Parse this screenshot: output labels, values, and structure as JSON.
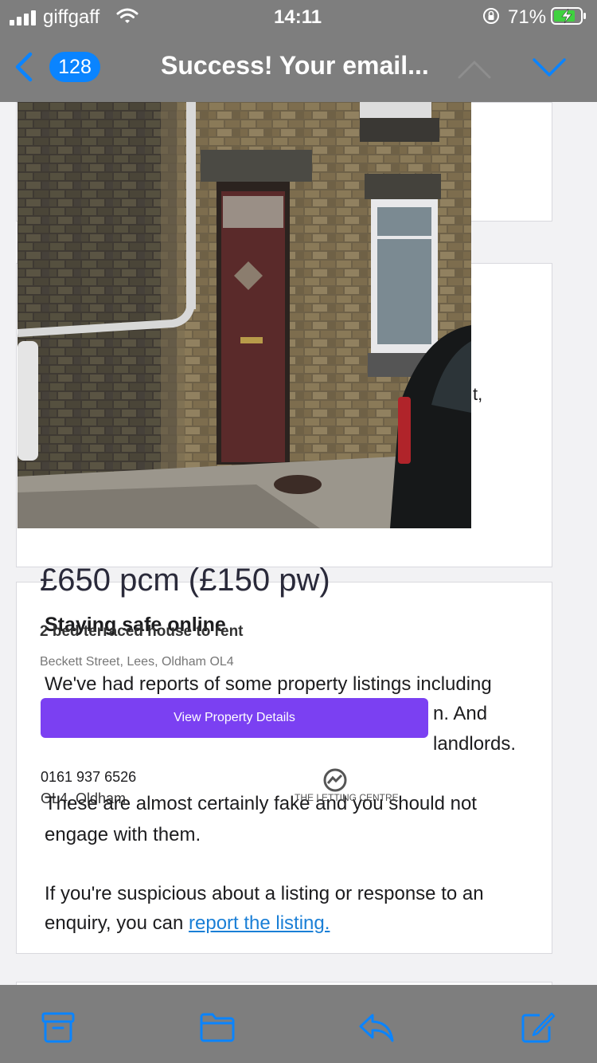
{
  "status_bar": {
    "carrier": "giffgaff",
    "time": "14:11",
    "battery_percent": "71%"
  },
  "nav": {
    "unread_count": "128",
    "title": "Success! Your email..."
  },
  "listing": {
    "fragment_text": "t,",
    "price": "£650 pcm (£150 pw)",
    "property_type": "2 bed terraced house to rent",
    "address": "Beckett Street, Lees, Oldham OL4",
    "view_button": "View Property Details",
    "phone": "0161 937 6526",
    "town": "OL4, Oldham",
    "logo_text": "THE LETTING CENTRE"
  },
  "safety": {
    "title": "Staying safe online",
    "line1": "We've had reports of some property listings including",
    "line2_end": "n. And",
    "line3_end": "landlords.",
    "line4": "These are almost certainly fake and you should not",
    "line5": "engage with them.",
    "line6": "If you're suspicious about a listing or response to an",
    "line7_prefix": "enquiry, you can",
    "report_link": "report the listing."
  },
  "toolbar": {
    "icons": [
      "archive-icon",
      "folder-icon",
      "reply-icon",
      "compose-icon"
    ]
  },
  "colors": {
    "accent": "#0a84ff",
    "button": "#7b40f2",
    "link": "#1a7fd6",
    "bars": "#7e7e7e"
  }
}
